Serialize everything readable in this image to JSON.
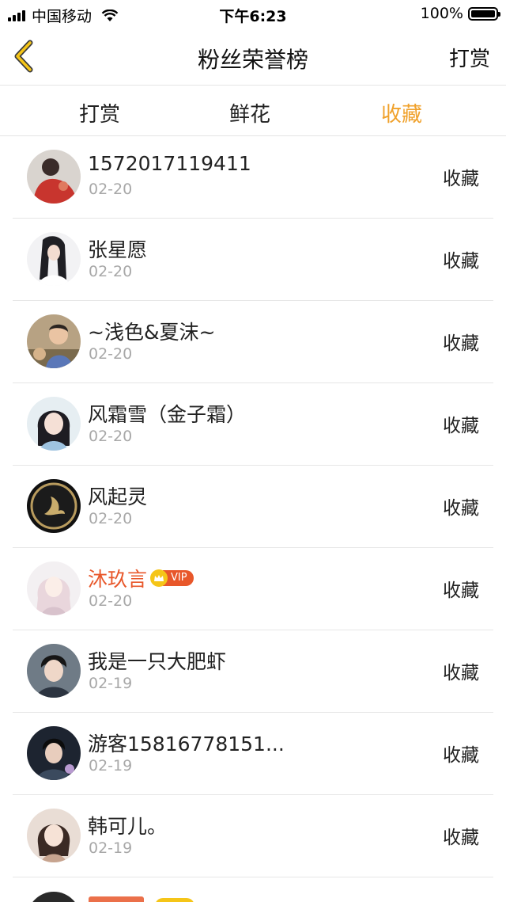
{
  "status_bar": {
    "carrier": "中国移动",
    "time": "下午6:23",
    "battery": "100%"
  },
  "nav": {
    "title": "粉丝荣誉榜",
    "right_action": "打赏",
    "back_icon": "chevron-left-icon",
    "accent_color": "#f0a12b"
  },
  "tabs": [
    {
      "label": "打赏",
      "active": false
    },
    {
      "label": "鲜花",
      "active": false
    },
    {
      "label": "收藏",
      "active": true
    }
  ],
  "list": [
    {
      "name": "1572017119411",
      "date": "02-20",
      "action": "收藏",
      "vip": false
    },
    {
      "name": "张星愿",
      "date": "02-20",
      "action": "收藏",
      "vip": false
    },
    {
      "name": "~浅色&夏沫~",
      "date": "02-20",
      "action": "收藏",
      "vip": false
    },
    {
      "name": "风霜雪（金子霜）",
      "date": "02-20",
      "action": "收藏",
      "vip": false
    },
    {
      "name": "风起灵",
      "date": "02-20",
      "action": "收藏",
      "vip": false
    },
    {
      "name": "沐玖言",
      "date": "02-20",
      "action": "收藏",
      "vip": true,
      "vip_label": "VIP"
    },
    {
      "name": "我是一只大肥虾",
      "date": "02-19",
      "action": "收藏",
      "vip": false
    },
    {
      "name": "游客15816778151...",
      "date": "02-19",
      "action": "收藏",
      "vip": false
    },
    {
      "name": "韩可儿。",
      "date": "02-19",
      "action": "收藏",
      "vip": false
    }
  ],
  "vip_color": "#e8572a"
}
